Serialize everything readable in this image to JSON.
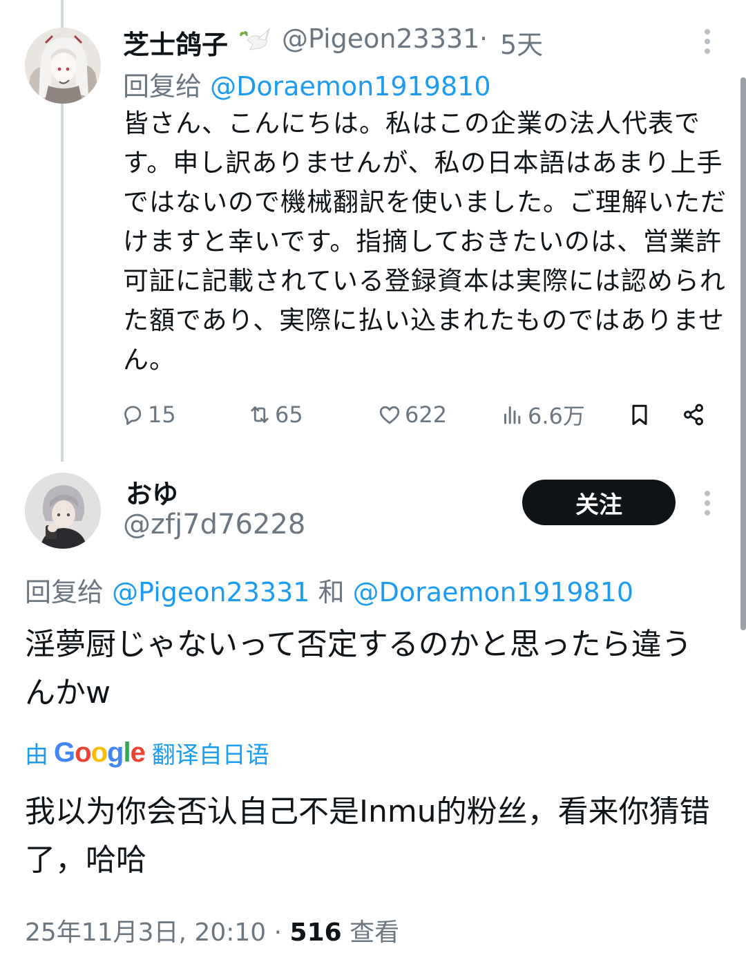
{
  "tweet1": {
    "display_name": "芝士鸽子",
    "badge_icon": "dove-olive-branch-icon",
    "handle": "@Pigeon23331",
    "separator": "·",
    "time_ago": "5天",
    "reply_prefix": "回复给",
    "reply_to": "@Doraemon1919810",
    "text": "皆さん、こんにちは。私はこの企業の法人代表です。申し訳ありませんが、私の日本語はあまり上手ではないので機械翻訳を使いました。ご理解いただけますと幸いです。指摘しておきたいのは、営業許可証に記載されている登録資本は実際には認められた額であり、実際に払い込まれたものではありません。",
    "actions": {
      "replies": "15",
      "retweets": "65",
      "likes": "622",
      "views": "6.6万"
    }
  },
  "tweet2": {
    "display_name": "おゆ",
    "handle": "@zfj7d76228",
    "follow_label": "关注",
    "reply_prefix": "回复给",
    "reply_to_1": "@Pigeon23331",
    "conjunction": "和",
    "reply_to_2": "@Doraemon1919810",
    "text": "淫夢厨じゃないって否定するのかと思ったら違うんかw",
    "translate": {
      "prefix": "由",
      "brand": "Google",
      "suffix": "翻译自日语"
    },
    "translated_text": "我以为你会否认自己不是Inmu的粉丝，看来你猜错了，哈哈",
    "meta": {
      "datetime": "25年11月3日, 20:10",
      "separator": "·",
      "views_count": "516",
      "views_label": "查看"
    }
  },
  "colors": {
    "text": "#0f1419",
    "secondary": "#6b7681",
    "link": "#1d9bf0",
    "button_bg": "#0f1419",
    "thread_line": "#cfd9de",
    "google_blue": "#4285f4",
    "google_red": "#ea4335",
    "google_yellow": "#fbbc05",
    "google_green": "#34a853"
  }
}
